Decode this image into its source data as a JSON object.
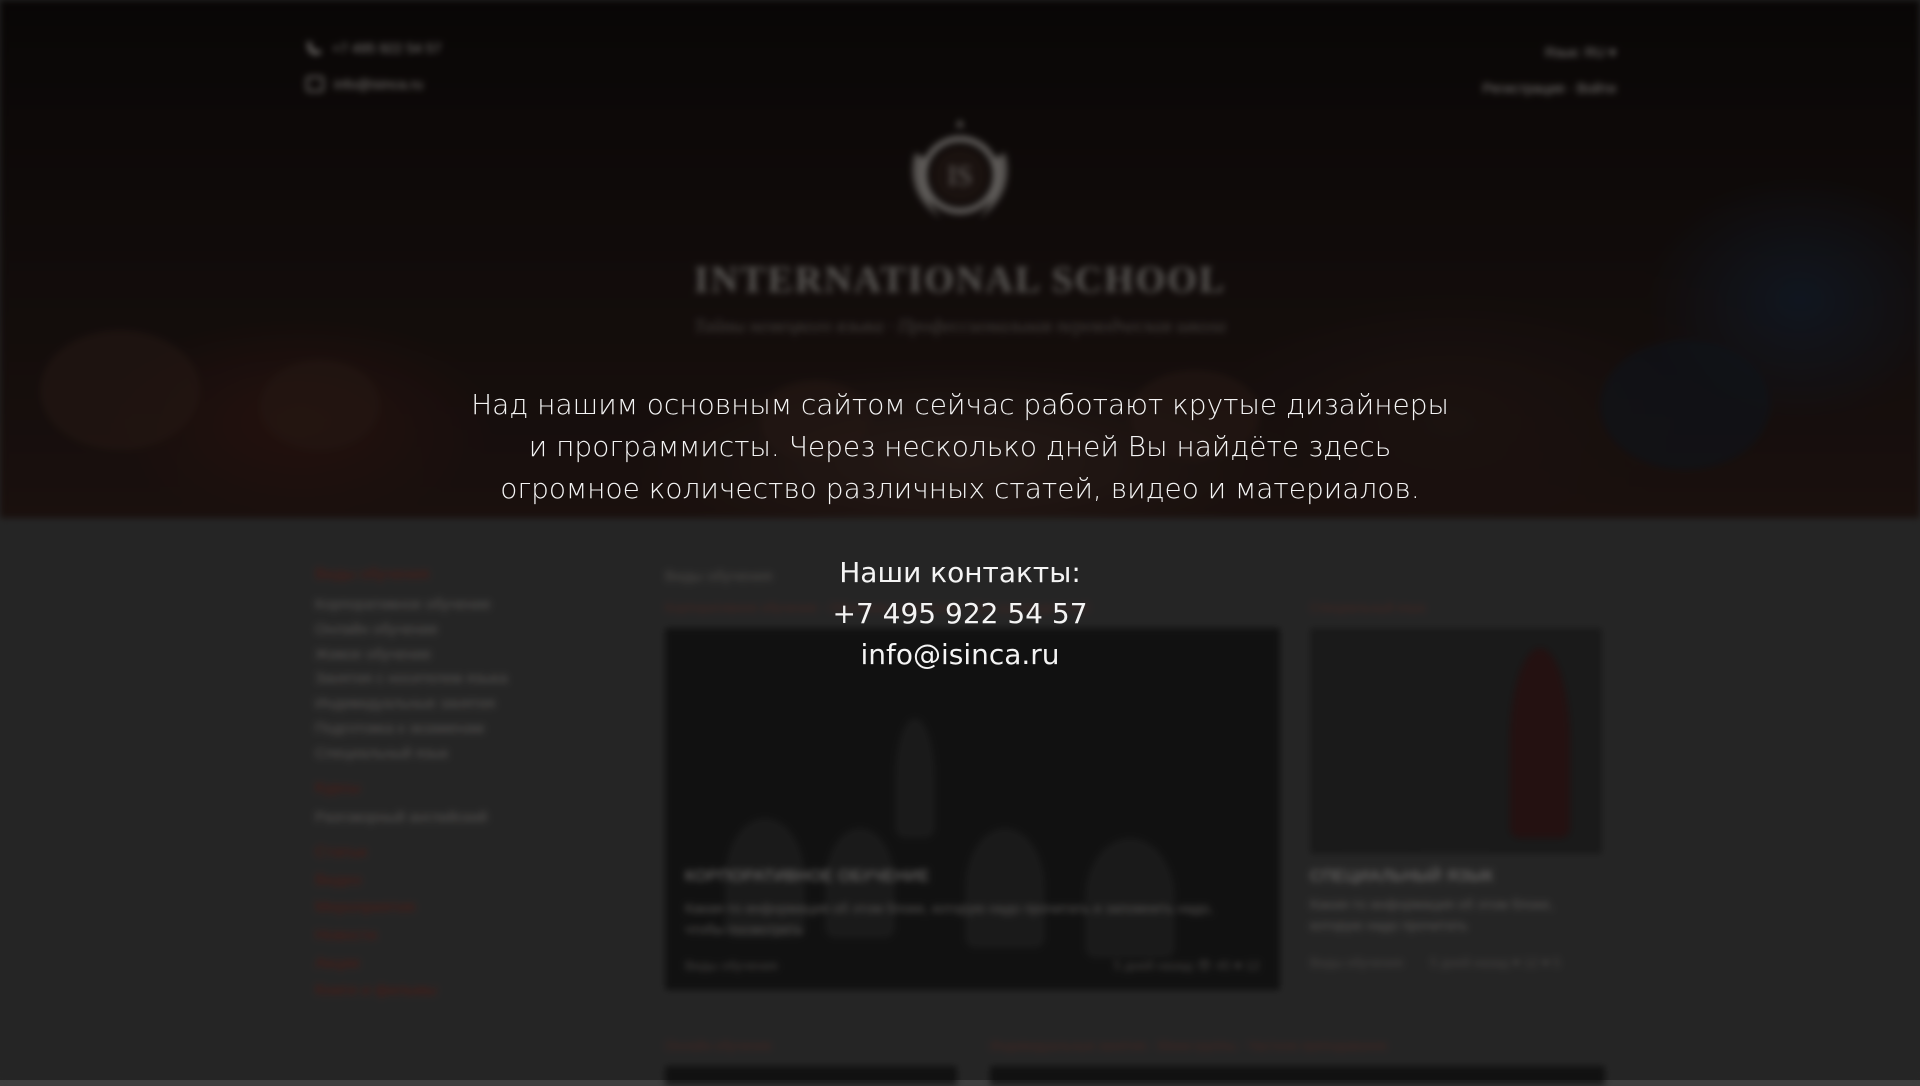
{
  "header": {
    "phone": "+7 495 922 54 57",
    "email": "info@isinca.ru",
    "language": "Язык: RU ▾",
    "auth": "Регистрация · Войти"
  },
  "brand": {
    "monogram": "IS",
    "name": "INTERNATIONAL SCHOOL",
    "tagline": "Тайны немецкого языка · Профессиональная переводческая школа"
  },
  "sidebar": {
    "section1_title": "Виды обучения",
    "section1_items": [
      "Корпоративное обучение",
      "Онлайн обучение",
      "Живое обучение",
      "Занятия с носителем языка",
      "Индивидуальные занятия",
      "Подготовка к экзаменам",
      "Специальный язык"
    ],
    "section2_title": "Курсы",
    "section2_items": [
      "Разговорный английский"
    ],
    "links": [
      "Статьи",
      "Видео",
      "Мероприятия",
      "Новости",
      "Акции",
      "Книги и фильмы"
    ]
  },
  "main": {
    "section_title": "Виды обучения",
    "card1": {
      "crumb": "Корпоративное обучение · Обучение в компании · Для руководителей",
      "title": "КОРПОРАТИВНОЕ ОБУЧЕНИЕ",
      "text": "Какая-то информация об этом блоке, которую надо прочитать и запомнить надо, чтобы посмотреть",
      "meta_left": "Виды обучения",
      "meta_right": "5 дней назад   👁 45   ♥ 12"
    },
    "card2": {
      "crumb": "Специальный язык",
      "title": "СПЕЦИАЛЬНЫЙ ЯЗЫК",
      "text": "Какая-то информация об этом блоке, которую надо прочитать",
      "meta_left": "Виды обучения",
      "meta_right": "5 дней назад   ♥ 12   ♥ 5"
    },
    "row2_crumb_left": "Онлайн обучение",
    "row2_crumb_right": "Индивидуальные занятия · Мини-группы · Частное преподавание"
  },
  "announcement": {
    "message": "Над нашим основным сайтом сейчас работают крутые дизайнеры и программисты. Через несколько дней Вы найдёте здесь огромное количество различных статей, видео и материалов.",
    "contacts_label": "Наши контакты:",
    "phone": "+7 495 922 54 57",
    "email": "info@isinca.ru"
  }
}
